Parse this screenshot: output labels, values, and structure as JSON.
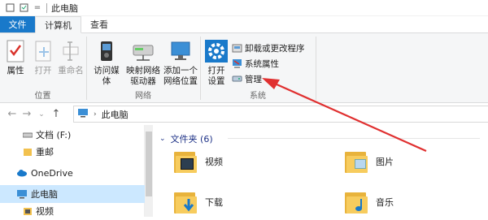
{
  "titlebar": {
    "title": "此电脑",
    "pin": "="
  },
  "tabs": [
    {
      "label": "文件"
    },
    {
      "label": "计算机"
    },
    {
      "label": "查看"
    }
  ],
  "ribbon": {
    "location": {
      "label": "位置",
      "properties": "属性",
      "open": "打开",
      "rename": "重命名"
    },
    "network": {
      "label": "网络",
      "media": "访问媒体",
      "map_drive_1": "映射网络",
      "map_drive_2": "驱动器",
      "add_loc_1": "添加一个",
      "add_loc_2": "网络位置"
    },
    "system": {
      "label": "系统",
      "open_settings_1": "打开",
      "open_settings_2": "设置",
      "uninstall": "卸载或更改程序",
      "sys_props": "系统属性",
      "manage": "管理"
    }
  },
  "address": {
    "path": "此电脑"
  },
  "nav": {
    "drive": "文档 (F:)",
    "folder": "重邮",
    "onedrive": "OneDrive",
    "thispc": "此电脑",
    "video": "视频"
  },
  "main": {
    "section": "文件夹 (6)",
    "folders": [
      "视频",
      "图片",
      "下载",
      "音乐"
    ]
  },
  "colors": {
    "accent": "#1979ca",
    "annotation_arrow": "#e03030"
  }
}
